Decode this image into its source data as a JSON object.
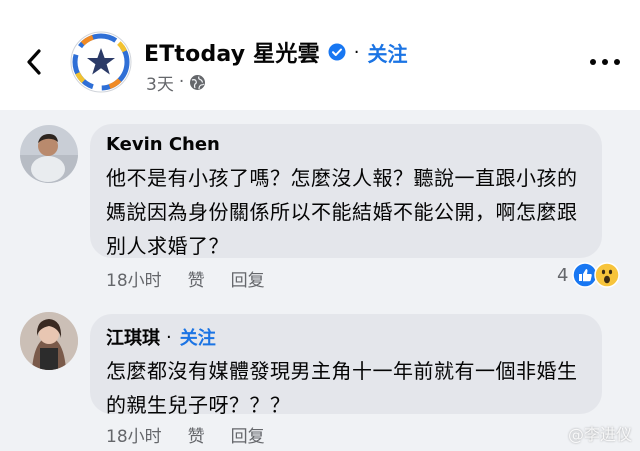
{
  "header": {
    "back_icon": "chevron-left-icon",
    "page_name": "ETtoday 星光雲",
    "follow_label": "关注",
    "dot": "·",
    "timestamp": "3天",
    "privacy_icon": "globe-icon",
    "more_icon": "more-horizontal-icon"
  },
  "comments": [
    {
      "author": "Kevin Chen",
      "text": "他不是有小孩了嗎？怎麼沒人報？聽說一直跟小孩的媽說因為身份關係所以不能結婚不能公開，啊怎麼跟別人求婚了？",
      "time": "18小时",
      "like_label": "赞",
      "reply_label": "回复",
      "reaction_count": "4",
      "reactions": [
        "like-reaction-icon",
        "wow-reaction-icon"
      ]
    },
    {
      "author": "江琪琪",
      "follow_label": "关注",
      "text": "怎麼都沒有媒體發現男主角十一年前就有一個非婚生的親生兒子呀？？？",
      "time": "18小时",
      "like_label": "赞",
      "reply_label": "回复"
    }
  ],
  "watermark": "@李进仪",
  "colors": {
    "accent": "#1b74e4",
    "bubble": "#e4e6eb",
    "background": "#f0f2f5",
    "secondary_text": "#65676b"
  }
}
